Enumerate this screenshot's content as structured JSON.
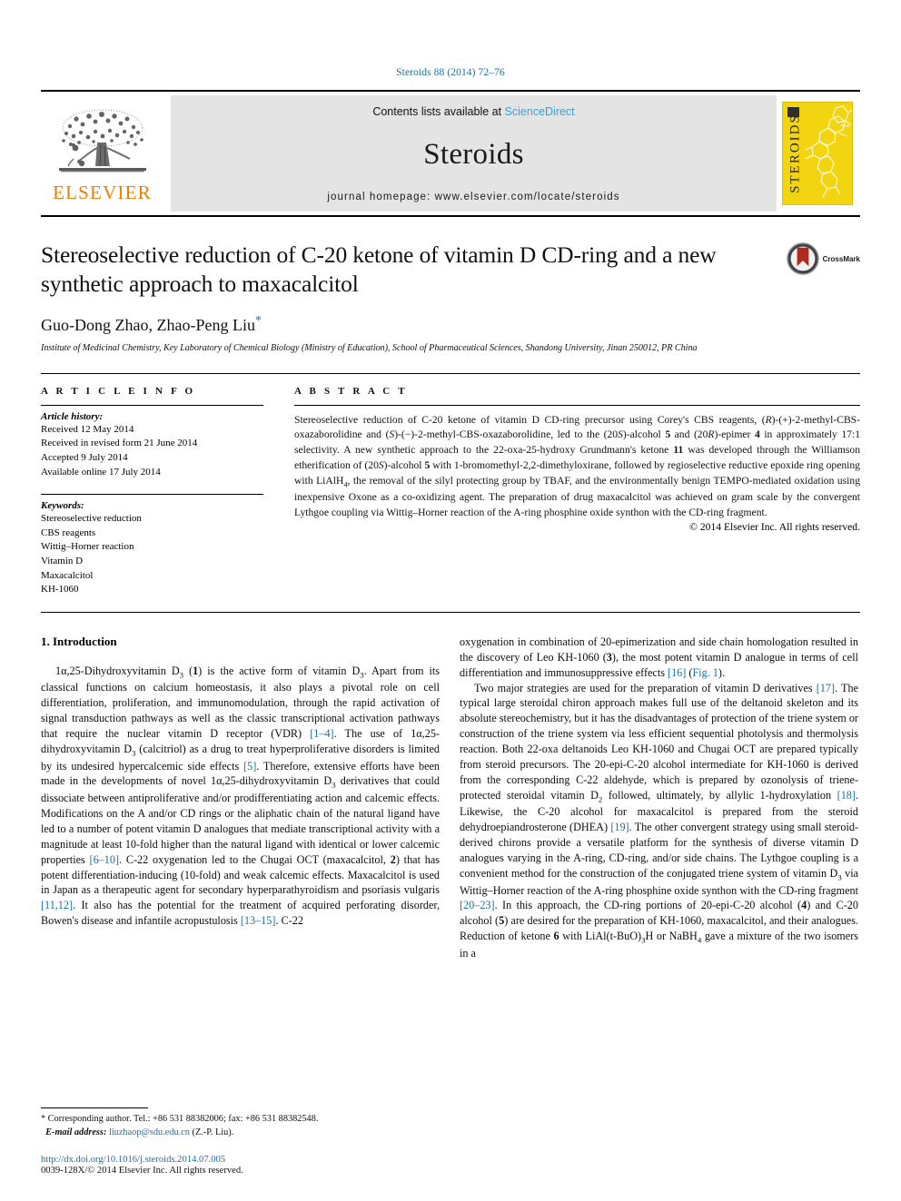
{
  "running_head": "Steroids 88 (2014) 72–76",
  "masthead": {
    "publisher_name": "ELSEVIER",
    "contents_prefix": "Contents lists available at ",
    "contents_link": "ScienceDirect",
    "journal_name": "Steroids",
    "homepage": "journal homepage: www.elsevier.com/locate/steroids",
    "cover_title": "STEROIDS"
  },
  "article": {
    "title": "Stereoselective reduction of C-20 ketone of vitamin D CD-ring and a new synthetic approach to maxacalcitol",
    "authors": "Guo-Dong Zhao, Zhao-Peng Liu",
    "corresponding_marker": "*",
    "affiliation": "Institute of Medicinal Chemistry, Key Laboratory of Chemical Biology (Ministry of Education), School of Pharmaceutical Sciences, Shandong University, Jinan 250012, PR China",
    "crossmark_label": "CrossMark"
  },
  "article_info": {
    "heading": "A R T I C L E   I N F O",
    "history_label": "Article history:",
    "history": [
      "Received 12 May 2014",
      "Received in revised form 21 June 2014",
      "Accepted 9 July 2014",
      "Available online 17 July 2014"
    ],
    "keywords_label": "Keywords:",
    "keywords": [
      "Stereoselective reduction",
      "CBS reagents",
      "Wittig–Horner reaction",
      "Vitamin D",
      "Maxacalcitol",
      "KH-1060"
    ]
  },
  "abstract": {
    "heading": "A B S T R A C T",
    "copyright": "© 2014 Elsevier Inc. All rights reserved."
  },
  "body": {
    "section_title": "1. Introduction",
    "footnote": {
      "marker": "*",
      "corresponding": "Corresponding author. Tel.: +86 531 88382006; fax: +86 531 88382548.",
      "email_label": "E-mail address:",
      "email": "liuzhaop@sdu.edu.cn",
      "email_suffix": "(Z.-P. Liu)."
    },
    "doi": "http://dx.doi.org/10.1016/j.steroids.2014.07.005",
    "issn": "0039-128X/© 2014 Elsevier Inc. All rights reserved."
  },
  "colors": {
    "accent_blue": "#1a6fa3",
    "sciencedirect_blue": "#3d9fd6",
    "elsevier_orange": "#f07c00",
    "cover_yellow": "#f2d510",
    "band_gray": "#e4e4e4"
  }
}
